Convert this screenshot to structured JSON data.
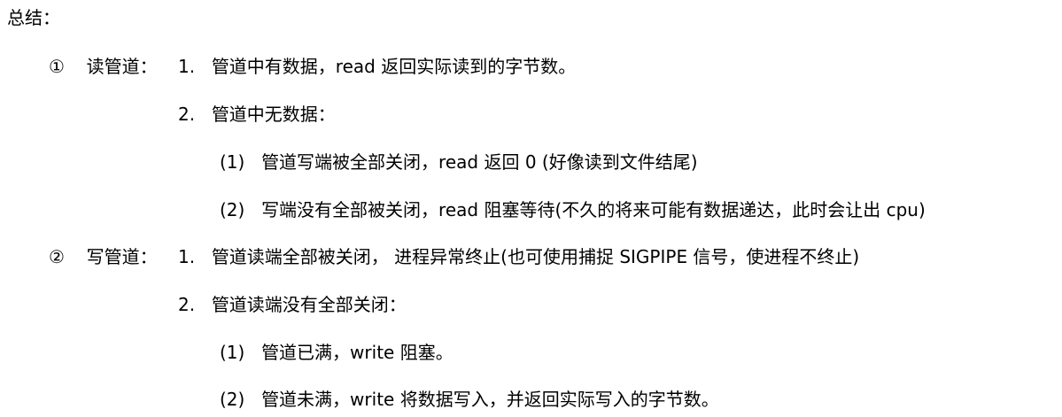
{
  "heading": "总结：",
  "sections": [
    {
      "marker": "①",
      "title": "读管道：",
      "items": [
        {
          "num": "1.",
          "text": "管道中有数据，read 返回实际读到的字节数。"
        },
        {
          "num": "2.",
          "text": "管道中无数据："
        }
      ],
      "subitems": [
        {
          "num": "(1)",
          "text": "管道写端被全部关闭，read 返回 0 (好像读到文件结尾)"
        },
        {
          "num": "(2)",
          "text": "写端没有全部被关闭，read 阻塞等待(不久的将来可能有数据递达，此时会让出 cpu)"
        }
      ]
    },
    {
      "marker": "②",
      "title": "写管道：",
      "items": [
        {
          "num": "1.",
          "text": "管道读端全部被关闭，  进程异常终止(也可使用捕捉 SIGPIPE 信号，使进程不终止)"
        },
        {
          "num": "2.",
          "text": "管道读端没有全部关闭："
        }
      ],
      "subitems": [
        {
          "num": "(1)",
          "text": "管道已满，write 阻塞。"
        },
        {
          "num": "(2)",
          "text": "管道未满，write 将数据写入，并返回实际写入的字节数。"
        }
      ]
    }
  ]
}
